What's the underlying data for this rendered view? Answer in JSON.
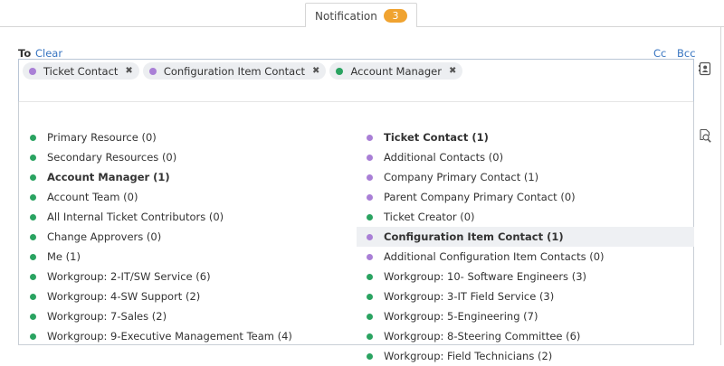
{
  "tab": {
    "label": "Notification",
    "count": "3"
  },
  "to": {
    "label": "To",
    "clear": "Clear",
    "cc": "Cc",
    "bcc": "Bcc"
  },
  "colors": {
    "green": "#2aa361",
    "purple": "#a97fd6",
    "link": "#3875c1",
    "badge": "#f0a330"
  },
  "selected": [
    {
      "label": "Ticket Contact",
      "color": "purple"
    },
    {
      "label": "Configuration Item Contact",
      "color": "purple"
    },
    {
      "label": "Account Manager",
      "color": "green"
    }
  ],
  "left_options": [
    {
      "label": "Primary Resource (0)",
      "color": "green",
      "bold": false
    },
    {
      "label": "Secondary Resources (0)",
      "color": "green",
      "bold": false
    },
    {
      "label": "Account Manager (1)",
      "color": "green",
      "bold": true
    },
    {
      "label": "Account Team (0)",
      "color": "green",
      "bold": false
    },
    {
      "label": "All Internal Ticket Contributors (0)",
      "color": "green",
      "bold": false
    },
    {
      "label": "Change Approvers (0)",
      "color": "green",
      "bold": false
    },
    {
      "label": "Me (1)",
      "color": "green",
      "bold": false
    },
    {
      "label": "Workgroup: 2-IT/SW Service (6)",
      "color": "green",
      "bold": false
    },
    {
      "label": "Workgroup: 4-SW Support (2)",
      "color": "green",
      "bold": false
    },
    {
      "label": "Workgroup: 7-Sales (2)",
      "color": "green",
      "bold": false
    },
    {
      "label": "Workgroup: 9-Executive Management Team (4)",
      "color": "green",
      "bold": false
    }
  ],
  "right_options": [
    {
      "label": "Ticket Contact (1)",
      "color": "purple",
      "bold": true
    },
    {
      "label": "Additional Contacts (0)",
      "color": "purple",
      "bold": false
    },
    {
      "label": "Company Primary Contact (1)",
      "color": "purple",
      "bold": false
    },
    {
      "label": "Parent Company Primary Contact (0)",
      "color": "purple",
      "bold": false
    },
    {
      "label": "Ticket Creator (0)",
      "color": "green",
      "bold": false
    },
    {
      "label": "Configuration Item Contact (1)",
      "color": "purple",
      "bold": true,
      "highlighted": true
    },
    {
      "label": "Additional Configuration Item Contacts (0)",
      "color": "purple",
      "bold": false
    },
    {
      "label": "Workgroup: 10- Software Engineers (3)",
      "color": "green",
      "bold": false
    },
    {
      "label": "Workgroup: 3-IT Field Service (3)",
      "color": "green",
      "bold": false
    },
    {
      "label": "Workgroup: 5-Engineering (7)",
      "color": "green",
      "bold": false
    },
    {
      "label": "Workgroup: 8-Steering Committee (6)",
      "color": "green",
      "bold": false
    },
    {
      "label": "Workgroup: Field Technicians (2)",
      "color": "green",
      "bold": false
    }
  ],
  "side_icons": [
    "contact-card-icon",
    "search-document-icon"
  ]
}
